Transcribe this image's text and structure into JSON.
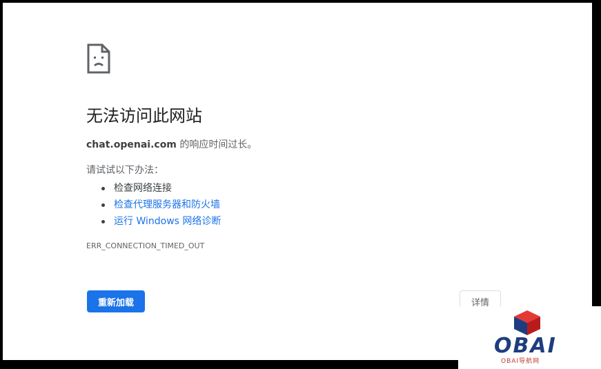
{
  "error_page": {
    "title": "无法访问此网站",
    "host": "chat.openai.com",
    "description_suffix": " 的响应时间过长。",
    "try_label": "请试试以下办法：",
    "suggestions": [
      {
        "text": "检查网络连接",
        "is_link": false
      },
      {
        "text": "检查代理服务器和防火墙",
        "is_link": true
      },
      {
        "text": "运行 Windows 网络诊断",
        "is_link": true
      }
    ],
    "error_code": "ERR_CONNECTION_TIMED_OUT",
    "reload_label": "重新加载",
    "details_label": "详情"
  },
  "watermark": {
    "logo_text": "OBAI",
    "subtitle": "OBAI导航网"
  },
  "colors": {
    "accent": "#1a73e8",
    "text_primary": "#202124",
    "text_secondary": "#5f6368",
    "logo_blue": "#1e3d80",
    "logo_red": "#d32f2f"
  },
  "icons": {
    "page_icon": "sad-page-icon"
  }
}
